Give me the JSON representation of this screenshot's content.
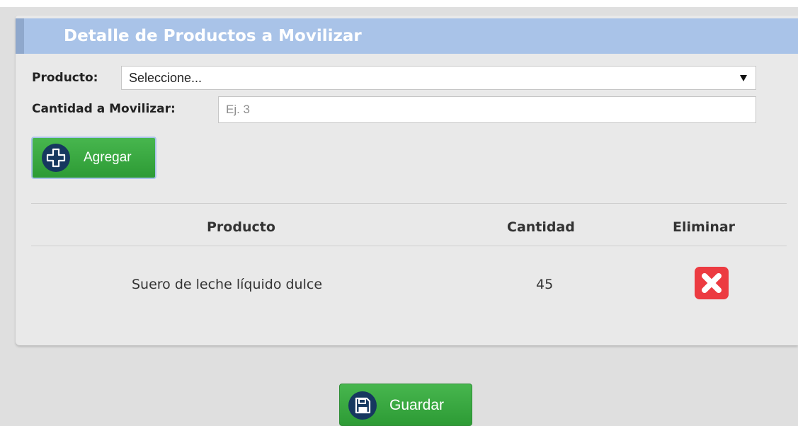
{
  "panel": {
    "title": "Detalle de Productos a Movilizar"
  },
  "form": {
    "product_label": "Producto:",
    "product_selected": "Seleccione...",
    "quantity_label": "Cantidad a Movilizar:",
    "quantity_placeholder": "Ej. 3",
    "quantity_value": ""
  },
  "buttons": {
    "add_label": "Agregar",
    "add_icon": "plus-icon",
    "save_label": "Guardar",
    "save_icon": "floppy-disk-icon"
  },
  "table": {
    "headers": [
      "Producto",
      "Cantidad",
      "Eliminar"
    ],
    "rows": [
      {
        "producto": "Suero de leche líquido dulce",
        "cantidad": "45",
        "eliminar_icon": "close-icon"
      }
    ]
  },
  "colors": {
    "header_bar": "#a9c3e8",
    "button_green": "#3aa842",
    "delete_red": "#ec3b41",
    "icon_navy": "#16385f"
  }
}
